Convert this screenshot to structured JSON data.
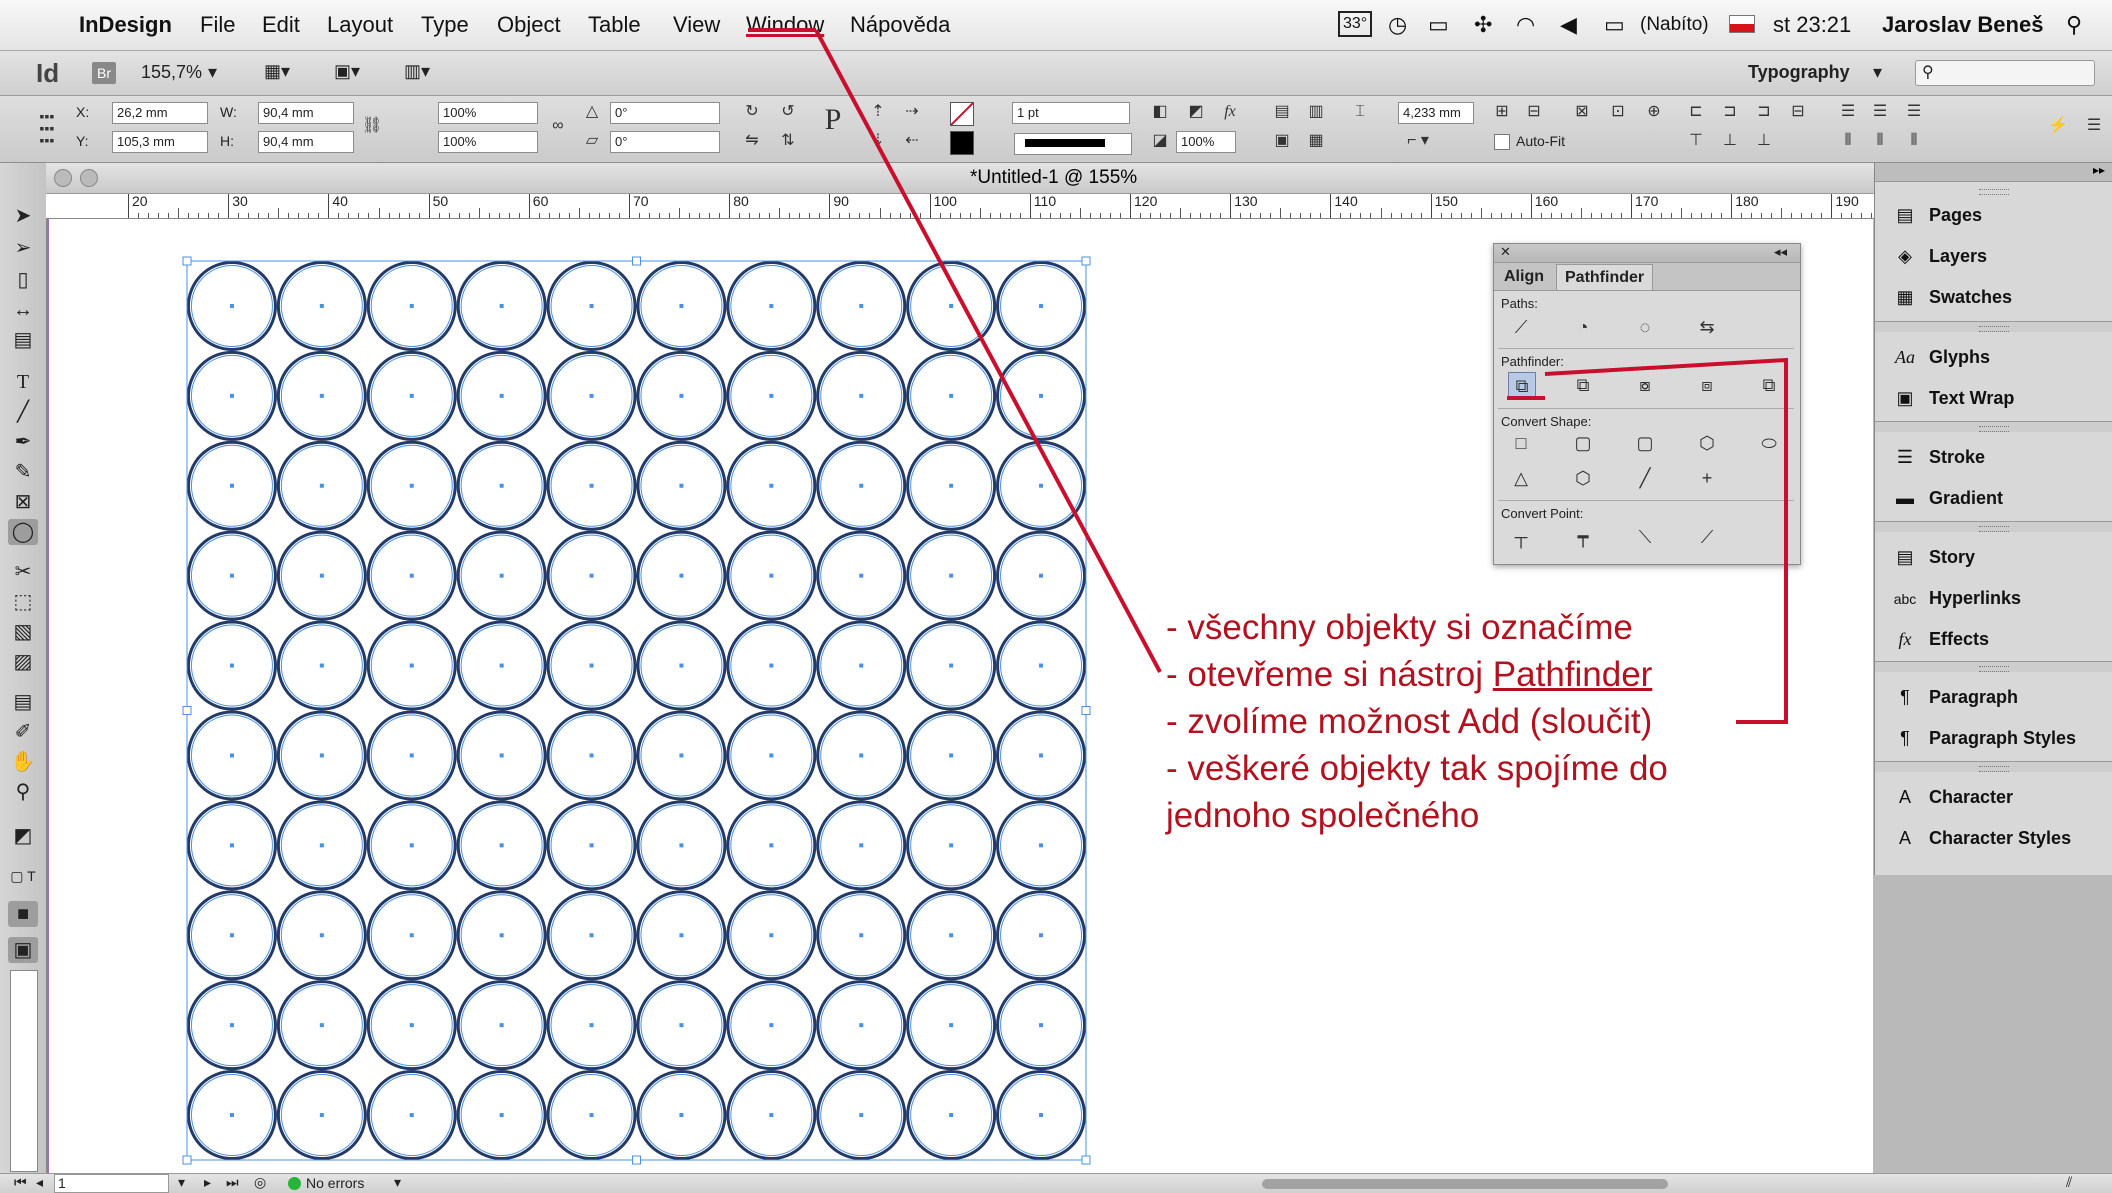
{
  "menubar": {
    "app": "InDesign",
    "items": [
      "File",
      "Edit",
      "Layout",
      "Type",
      "Object",
      "Table",
      "View",
      "Window",
      "Nápověda"
    ],
    "status_temp": "33°",
    "battery": "(Nabíto)",
    "clock": "st 23:21",
    "user": "Jaroslav Beneš"
  },
  "appbar": {
    "id_logo": "Id",
    "br_logo": "Br",
    "zoom": "155,7%",
    "workspace": "Typography"
  },
  "control": {
    "x_label": "X:",
    "x_value": "26,2 mm",
    "y_label": "Y:",
    "y_value": "105,3 mm",
    "w_label": "W:",
    "w_value": "90,4 mm",
    "h_label": "H:",
    "h_value": "90,4 mm",
    "scale_x": "100%",
    "scale_y": "100%",
    "rotate": "0°",
    "shear": "0°",
    "stroke_weight": "1 pt",
    "opacity": "100%",
    "offset": "4,233 mm",
    "autofit": "Auto-Fit"
  },
  "document": {
    "title": "*Untitled-1 @ 155%",
    "ruler_ticks": [
      "20",
      "30",
      "40",
      "50",
      "60",
      "70",
      "80",
      "90",
      "100",
      "110",
      "120",
      "130",
      "140",
      "150",
      "160",
      "170",
      "180",
      "190"
    ]
  },
  "pathfinder": {
    "tabs": [
      "Align",
      "Pathfinder"
    ],
    "active_tab": "Pathfinder",
    "sections": [
      "Paths:",
      "Pathfinder:",
      "Convert Shape:",
      "Convert Point:"
    ]
  },
  "panels": {
    "items": [
      "Pages",
      "Layers",
      "Swatches",
      "Glyphs",
      "Text Wrap",
      "Stroke",
      "Gradient",
      "Story",
      "Hyperlinks",
      "Effects",
      "Paragraph",
      "Paragraph Styles",
      "Character",
      "Character Styles"
    ]
  },
  "grid": {
    "rows": 10,
    "cols": 10
  },
  "annotation": {
    "line1": "- všechny objekty si označíme",
    "line2_pre": "- otevřeme si nástroj ",
    "line2_link": "Pathfinder",
    "line3": "- zvolíme možnost Add (sloučit)",
    "line4": "- veškeré objekty tak spojíme do",
    "line5": "jednoho společného",
    "color": "#b2121f"
  },
  "status": {
    "page": "1",
    "preflight": "No errors"
  },
  "colors": {
    "circle_stroke": "#233a66",
    "selection": "#4a90e2",
    "annotation_red": "#c8102e"
  }
}
